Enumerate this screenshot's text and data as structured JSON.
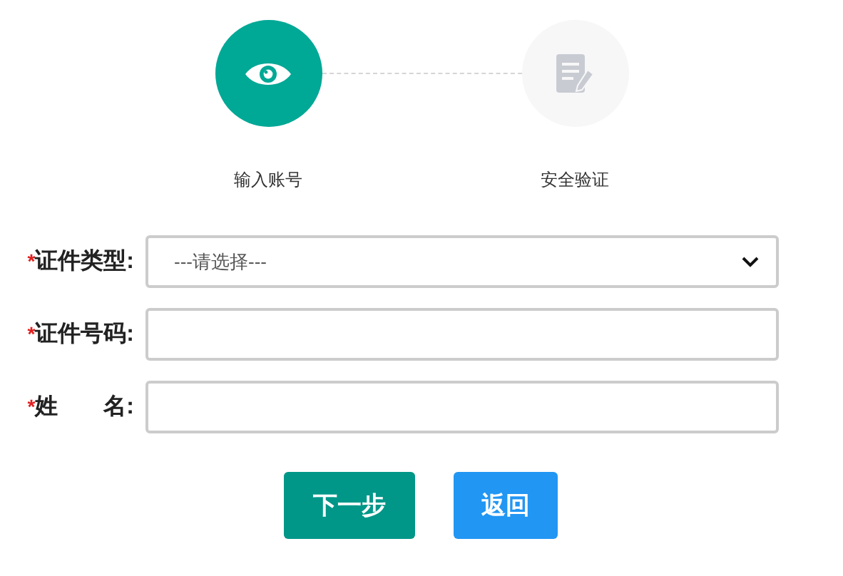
{
  "steps": [
    {
      "label": "输入账号",
      "kind": "eye",
      "selected": true
    },
    {
      "label": "安全验证",
      "kind": "document",
      "selected": false
    }
  ],
  "fields": [
    {
      "mark": "*",
      "label": "证件类型:",
      "kind": "select",
      "placeholder": "---请选择---"
    },
    {
      "mark": "*",
      "label": "证件号码:",
      "kind": "input"
    },
    {
      "mark": "*",
      "label": "姓　　名:",
      "kind": "input"
    }
  ],
  "buttons": [
    {
      "label": "下一步",
      "kind": "primary"
    },
    {
      "label": "返回",
      "kind": "secondary"
    }
  ]
}
